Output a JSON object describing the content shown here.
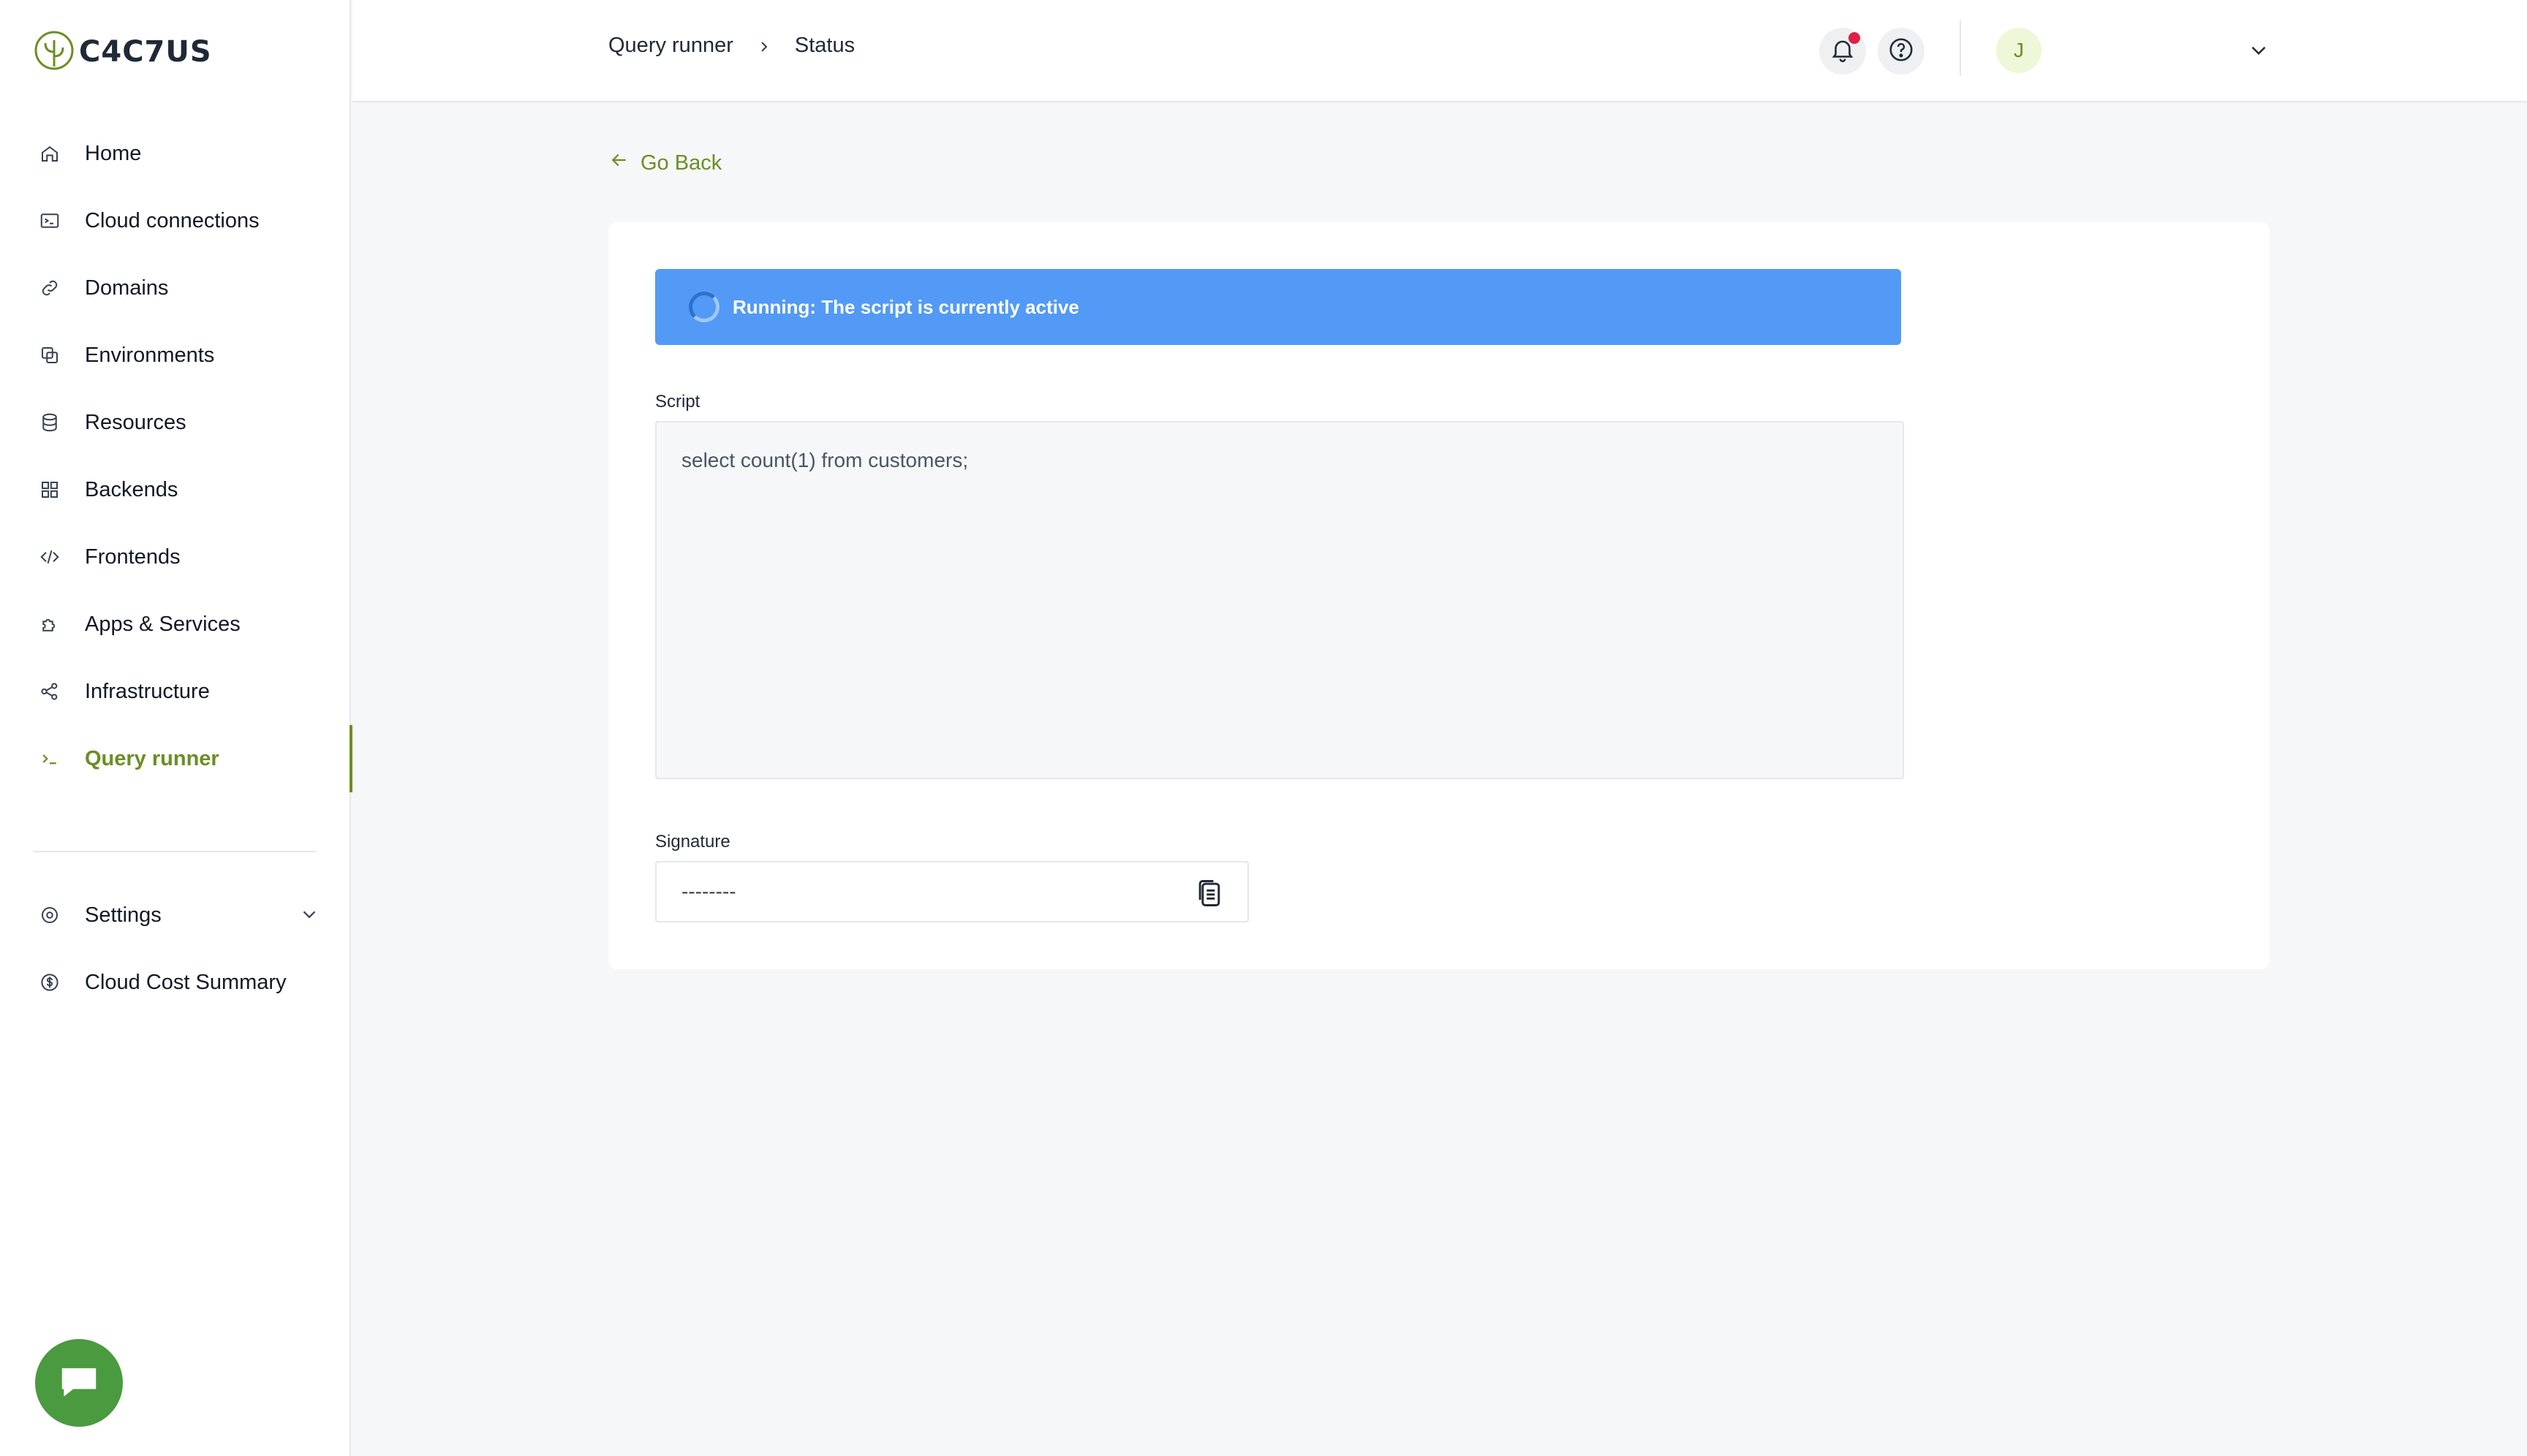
{
  "brand": {
    "name": "C4C7US",
    "accent": "#6b8e23"
  },
  "sidebar": {
    "items": [
      {
        "label": "Home",
        "icon": "home-icon"
      },
      {
        "label": "Cloud connections",
        "icon": "terminal-window-icon"
      },
      {
        "label": "Domains",
        "icon": "link-icon"
      },
      {
        "label": "Environments",
        "icon": "environments-icon"
      },
      {
        "label": "Resources",
        "icon": "database-icon"
      },
      {
        "label": "Backends",
        "icon": "grid-icon"
      },
      {
        "label": "Frontends",
        "icon": "code-icon"
      },
      {
        "label": "Apps & Services",
        "icon": "puzzle-icon"
      },
      {
        "label": "Infrastructure",
        "icon": "share-nodes-icon"
      },
      {
        "label": "Query runner",
        "icon": "prompt-icon",
        "active": true
      }
    ],
    "bottom_items": [
      {
        "label": "Settings",
        "icon": "gear-icon"
      },
      {
        "label": "Cloud Cost Summary",
        "icon": "dollar-icon"
      }
    ]
  },
  "header": {
    "breadcrumb": [
      "Query runner",
      "Status"
    ],
    "avatar_initial": "J"
  },
  "main": {
    "go_back_label": "Go Back",
    "status": {
      "text": "Running: The script is currently active",
      "color": "#529af5"
    },
    "script": {
      "label": "Script",
      "value": "select count(1) from customers;"
    },
    "signature": {
      "label": "Signature",
      "value": "--------"
    }
  }
}
